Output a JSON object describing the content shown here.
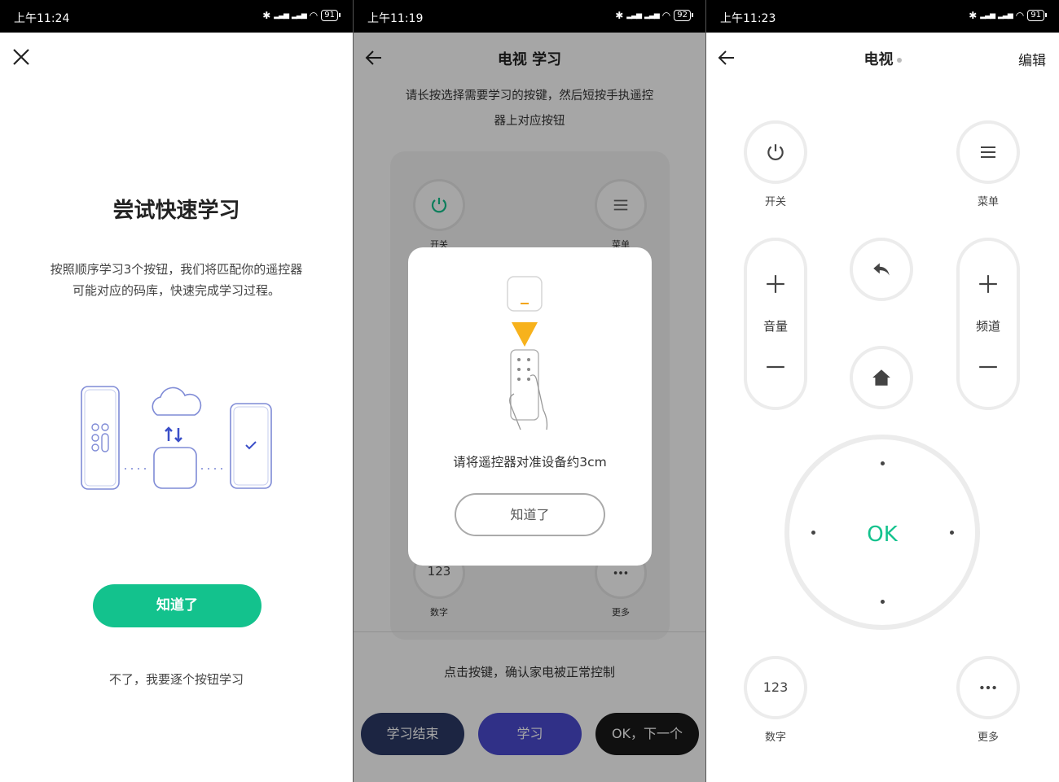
{
  "panel1": {
    "status": {
      "time": "上午11:24",
      "battery": "91"
    },
    "title": "尝试快速学习",
    "desc_line1": "按照顺序学习3个按钮，我们将匹配你的遥控器",
    "desc_line2": "可能对应的码库，快速完成学习过程。",
    "confirm_button": "知道了",
    "skip_link": "不了，我要逐个按钮学习"
  },
  "panel2": {
    "status": {
      "time": "上午11:19",
      "battery": "92"
    },
    "title": "电视 学习",
    "instr_line1": "请长按选择需要学习的按键，然后短按手执遥控",
    "instr_line2": "器上对应按钮",
    "btn_power_label": "开关",
    "btn_menu_label": "菜单",
    "btn_number_text": "123",
    "btn_number_label": "数字",
    "btn_more_label": "更多",
    "bottom_text": "点击按键，确认家电被正常控制",
    "pill_end": "学习结束",
    "pill_learn": "学习",
    "pill_next": "OK，下一个",
    "dialog": {
      "text": "请将遥控器对准设备约3cm",
      "button": "知道了"
    }
  },
  "panel3": {
    "status": {
      "time": "上午11:23",
      "battery": "91"
    },
    "title": "电视",
    "edit": "编辑",
    "power_label": "开关",
    "menu_label": "菜单",
    "volume_label": "音量",
    "channel_label": "频道",
    "ok_label": "OK",
    "number_text": "123",
    "number_label": "数字",
    "more_label": "更多"
  },
  "colors": {
    "accent": "#13c28d",
    "pill_blue": "#4a4ad0",
    "pill_navy": "#2b3a66",
    "pill_black": "#1a1a1a"
  },
  "icons": [
    "close-icon",
    "back-arrow-icon",
    "power-icon",
    "menu-icon",
    "plus-icon",
    "minus-icon",
    "return-icon",
    "home-icon",
    "more-dots-icon",
    "bluetooth-icon",
    "signal-icon",
    "wifi-icon",
    "battery-icon"
  ]
}
